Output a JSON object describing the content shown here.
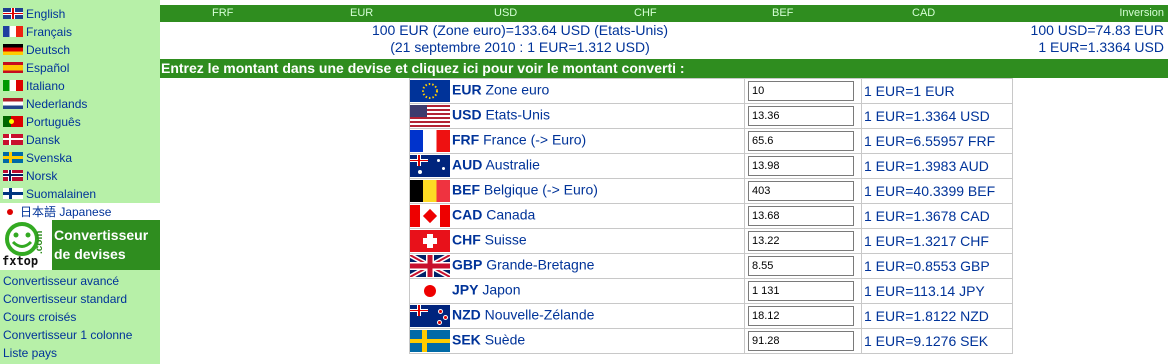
{
  "sidebar": {
    "languages": [
      {
        "label": "English",
        "flag": "uk-flag-icon"
      },
      {
        "label": "Français",
        "flag": "france-flag-icon"
      },
      {
        "label": "Deutsch",
        "flag": "germany-flag-icon"
      },
      {
        "label": "Español",
        "flag": "spain-flag-icon"
      },
      {
        "label": "Italiano",
        "flag": "italy-flag-icon"
      },
      {
        "label": "Nederlands",
        "flag": "netherlands-flag-icon"
      },
      {
        "label": "Português",
        "flag": "portugal-flag-icon"
      },
      {
        "label": "Dansk",
        "flag": "denmark-flag-icon"
      },
      {
        "label": "Svenska",
        "flag": "sweden-flag-icon"
      },
      {
        "label": "Norsk",
        "flag": "norway-flag-icon"
      },
      {
        "label": "Suomalainen",
        "flag": "finland-flag-icon"
      },
      {
        "label": "日本語 Japanese",
        "flag": "japan-flag-icon"
      }
    ],
    "logo": {
      "brand": "fxtop",
      "dotcom": ".com",
      "title_line1": "Convertisseur",
      "title_line2": "de devises"
    },
    "links": [
      "Convertisseur avancé",
      "Convertisseur standard",
      "Cours croisés",
      "Convertisseur 1 colonne",
      "Liste pays"
    ]
  },
  "header": {
    "currencies": [
      "FRF",
      "EUR",
      "USD",
      "CHF",
      "BEF",
      "CAD"
    ],
    "inversion": "Inversion",
    "info_line1": "100 EUR (Zone euro)=133.64 USD (Etats-Unis)",
    "info_line2": "(21 septembre 2010 : 1 EUR=1.312 USD)",
    "rate_line1": "100 USD=74.83 EUR",
    "rate_line2": "1 EUR=1.3364 USD",
    "instruction": "Entrez le montant dans une devise et cliquez ici pour voir le montant converti :"
  },
  "colors": {
    "green_bar": "#2f8d1f",
    "sidebar_bg": "#b7f0a8",
    "link": "#003399"
  },
  "rows": [
    {
      "code": "EUR",
      "name": "Zone euro",
      "amount": "10",
      "rate": "1 EUR=1 EUR",
      "flag": "eu-flag-icon"
    },
    {
      "code": "USD",
      "name": "Etats-Unis",
      "amount": "13.36",
      "rate": "1 EUR=1.3364 USD",
      "flag": "usa-flag-icon"
    },
    {
      "code": "FRF",
      "name": "France (-> Euro)",
      "amount": "65.6",
      "rate": "1 EUR=6.55957 FRF",
      "flag": "france-flag-icon"
    },
    {
      "code": "AUD",
      "name": "Australie",
      "amount": "13.98",
      "rate": "1 EUR=1.3983 AUD",
      "flag": "australia-flag-icon"
    },
    {
      "code": "BEF",
      "name": "Belgique (-> Euro)",
      "amount": "403",
      "rate": "1 EUR=40.3399 BEF",
      "flag": "belgium-flag-icon"
    },
    {
      "code": "CAD",
      "name": "Canada",
      "amount": "13.68",
      "rate": "1 EUR=1.3678 CAD",
      "flag": "canada-flag-icon"
    },
    {
      "code": "CHF",
      "name": "Suisse",
      "amount": "13.22",
      "rate": "1 EUR=1.3217 CHF",
      "flag": "switzerland-flag-icon"
    },
    {
      "code": "GBP",
      "name": "Grande-Bretagne",
      "amount": "8.55",
      "rate": "1 EUR=0.8553 GBP",
      "flag": "uk-flag-icon"
    },
    {
      "code": "JPY",
      "name": "Japon",
      "amount": "1 131",
      "rate": "1 EUR=113.14 JPY",
      "flag": "japan-flag-icon"
    },
    {
      "code": "NZD",
      "name": "Nouvelle-Zélande",
      "amount": "18.12",
      "rate": "1 EUR=1.8122 NZD",
      "flag": "new-zealand-flag-icon"
    },
    {
      "code": "SEK",
      "name": "Suède",
      "amount": "91.28",
      "rate": "1 EUR=9.1276 SEK",
      "flag": "sweden-flag-icon"
    }
  ]
}
